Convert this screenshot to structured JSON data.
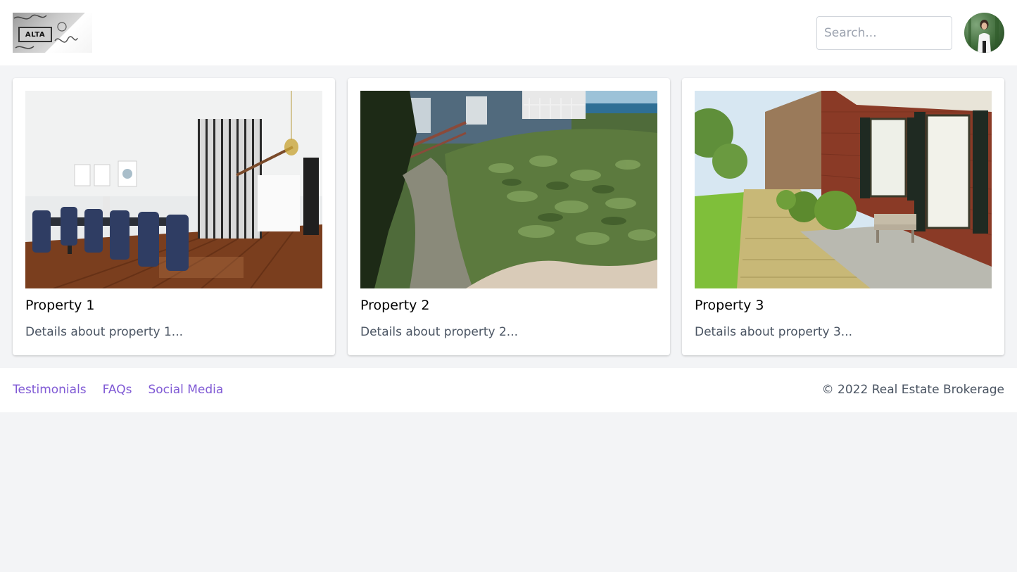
{
  "header": {
    "logo_text": "ALTA",
    "search_placeholder": "Search..."
  },
  "properties": [
    {
      "title": "Property 1",
      "description": "Details about property 1..."
    },
    {
      "title": "Property 2",
      "description": "Details about property 2..."
    },
    {
      "title": "Property 3",
      "description": "Details about property 3..."
    }
  ],
  "footer": {
    "links": [
      "Testimonials",
      "FAQs",
      "Social Media"
    ],
    "copyright": "© 2022 Real Estate Brokerage"
  },
  "colors": {
    "page_background": "#f3f4f6",
    "link": "#805ad5",
    "muted_text": "#4b5563"
  }
}
